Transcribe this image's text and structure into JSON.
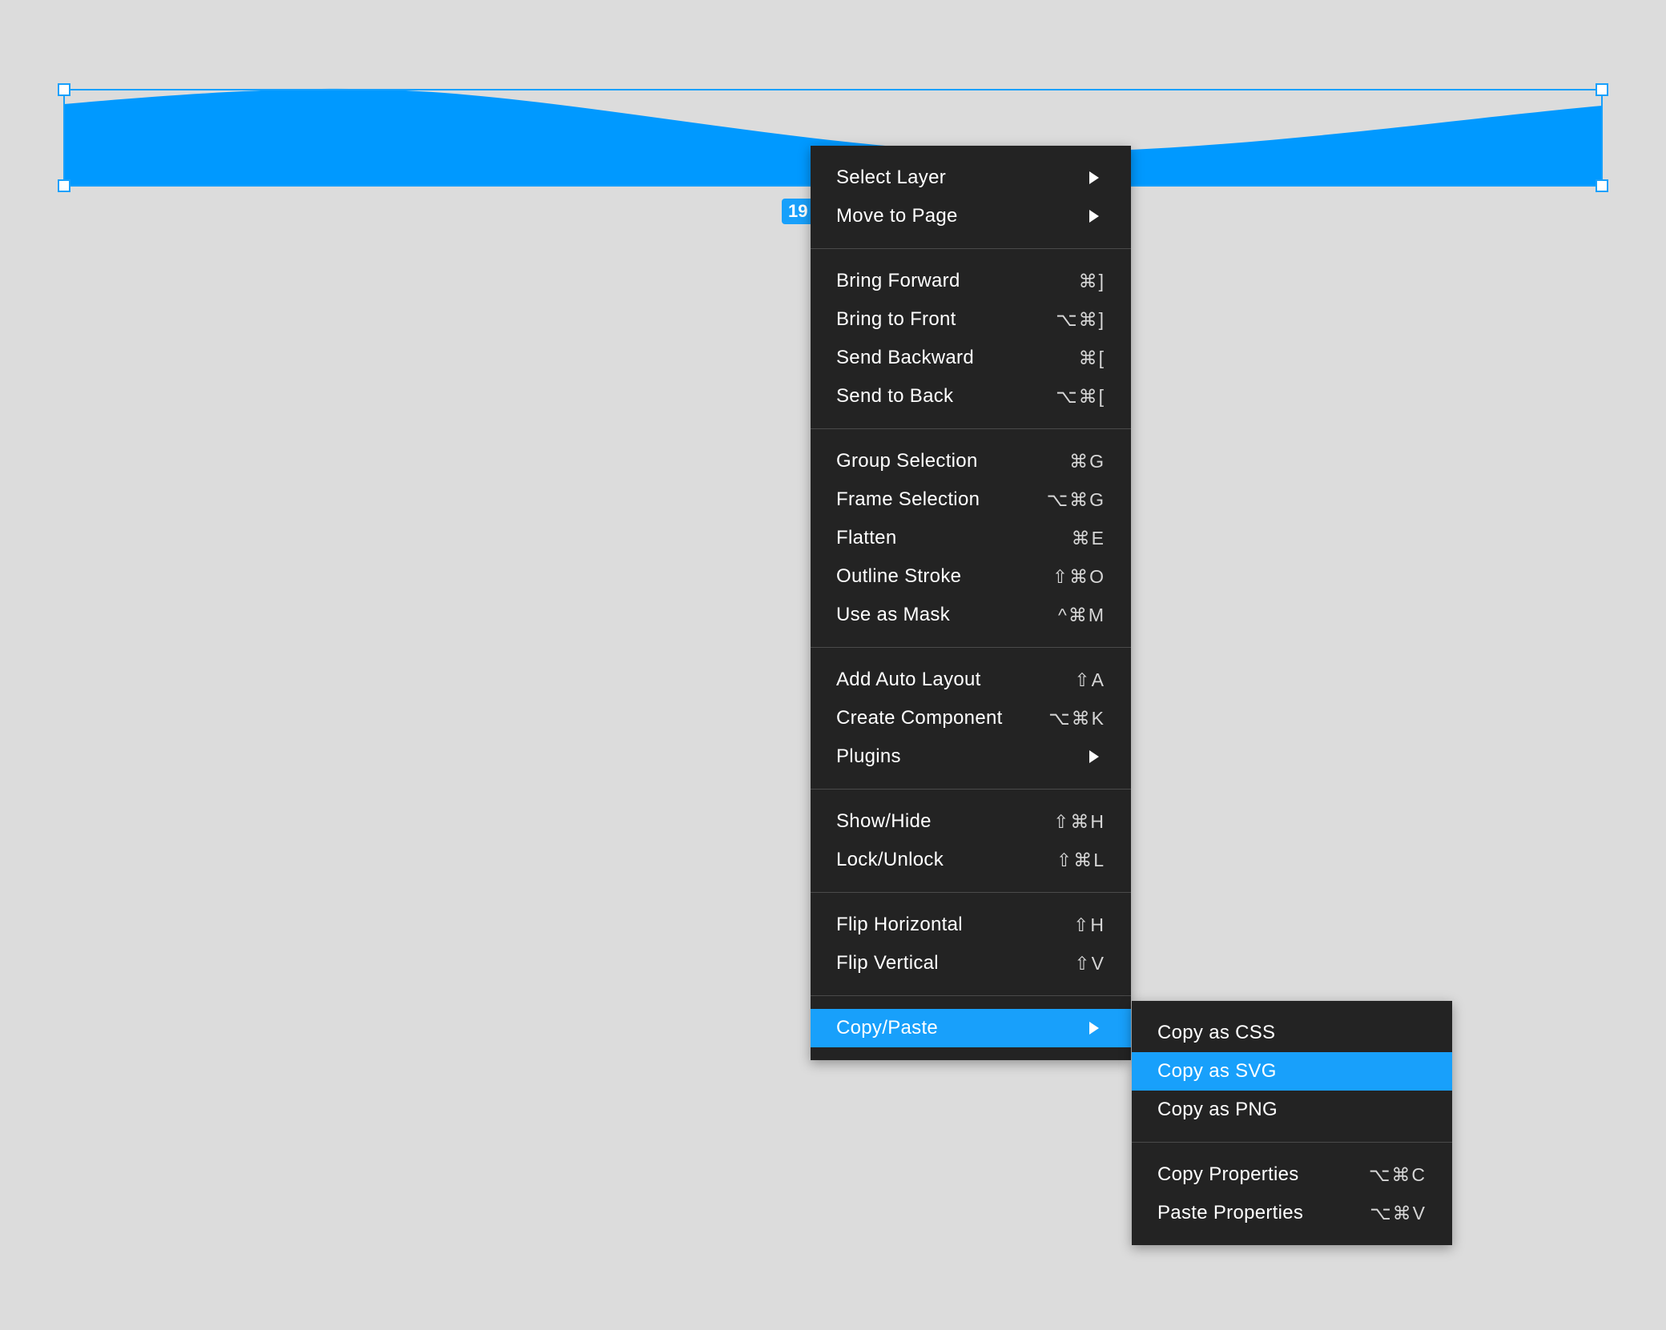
{
  "canvas": {
    "selection_dimensions_label": "19",
    "shape_color": "#0099ff",
    "selection_color": "#18a0fb"
  },
  "context_menu": {
    "groups": [
      [
        {
          "label": "Select Layer",
          "shortcut": "",
          "submenu": true
        },
        {
          "label": "Move to Page",
          "shortcut": "",
          "submenu": true
        }
      ],
      [
        {
          "label": "Bring Forward",
          "shortcut": "⌘]"
        },
        {
          "label": "Bring to Front",
          "shortcut": "⌥⌘]"
        },
        {
          "label": "Send Backward",
          "shortcut": "⌘["
        },
        {
          "label": "Send to Back",
          "shortcut": "⌥⌘["
        }
      ],
      [
        {
          "label": "Group Selection",
          "shortcut": "⌘G"
        },
        {
          "label": "Frame Selection",
          "shortcut": "⌥⌘G"
        },
        {
          "label": "Flatten",
          "shortcut": "⌘E"
        },
        {
          "label": "Outline Stroke",
          "shortcut": "⇧⌘O"
        },
        {
          "label": "Use as Mask",
          "shortcut": "^⌘M"
        }
      ],
      [
        {
          "label": "Add Auto Layout",
          "shortcut": "⇧A"
        },
        {
          "label": "Create Component",
          "shortcut": "⌥⌘K"
        },
        {
          "label": "Plugins",
          "shortcut": "",
          "submenu": true
        }
      ],
      [
        {
          "label": "Show/Hide",
          "shortcut": "⇧⌘H"
        },
        {
          "label": "Lock/Unlock",
          "shortcut": "⇧⌘L"
        }
      ],
      [
        {
          "label": "Flip Horizontal",
          "shortcut": "⇧H"
        },
        {
          "label": "Flip Vertical",
          "shortcut": "⇧V"
        }
      ],
      [
        {
          "label": "Copy/Paste",
          "shortcut": "",
          "submenu": true,
          "active": true
        }
      ]
    ]
  },
  "submenu": {
    "groups": [
      [
        {
          "label": "Copy as CSS",
          "shortcut": ""
        },
        {
          "label": "Copy as SVG",
          "shortcut": "",
          "active": true
        },
        {
          "label": "Copy as PNG",
          "shortcut": ""
        }
      ],
      [
        {
          "label": "Copy Properties",
          "shortcut": "⌥⌘C"
        },
        {
          "label": "Paste Properties",
          "shortcut": "⌥⌘V"
        }
      ]
    ]
  }
}
